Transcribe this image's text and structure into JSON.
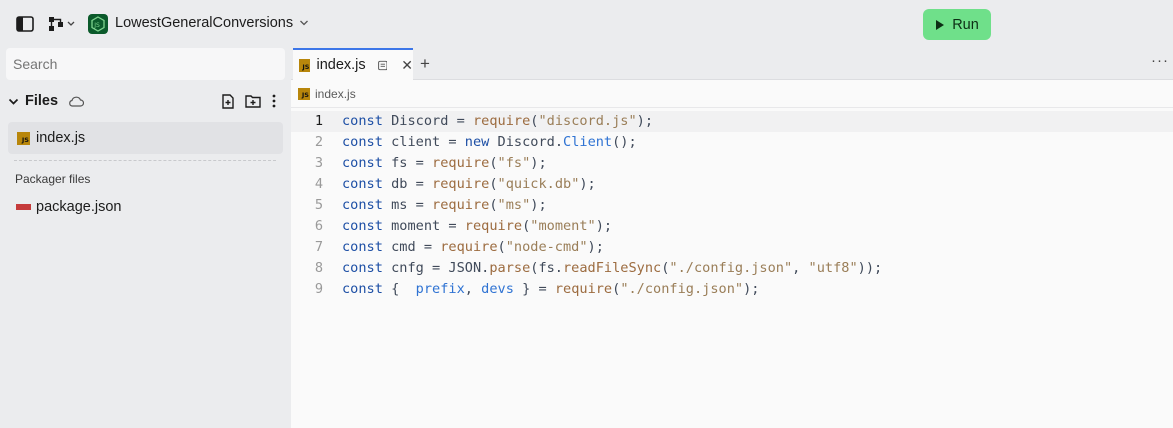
{
  "topbar": {
    "repl_name": "LowestGeneralConversions",
    "run_label": "Run"
  },
  "sidebar": {
    "search_placeholder": "Search",
    "files_title": "Files",
    "files": [
      {
        "name": "index.js",
        "icon": "js-file-icon"
      }
    ],
    "packager_label": "Packager files",
    "packager_files": [
      {
        "name": "package.json",
        "icon": "npm-icon"
      }
    ]
  },
  "editor": {
    "tab_label": "index.js",
    "breadcrumb": "index.js",
    "lines": [
      {
        "n": "1",
        "tokens": [
          [
            "kw",
            "const"
          ],
          [
            "id",
            " Discord "
          ],
          [
            "pu",
            "= "
          ],
          [
            "fn",
            "require"
          ],
          [
            "pu",
            "("
          ],
          [
            "str",
            "\"discord.js\""
          ],
          [
            "pu",
            ");"
          ]
        ]
      },
      {
        "n": "2",
        "tokens": [
          [
            "kw",
            "const"
          ],
          [
            "id",
            " client "
          ],
          [
            "pu",
            "= "
          ],
          [
            "kw",
            "new"
          ],
          [
            "id",
            " Discord."
          ],
          [
            "cls",
            "Client"
          ],
          [
            "pu",
            "();"
          ]
        ]
      },
      {
        "n": "3",
        "tokens": [
          [
            "kw",
            "const"
          ],
          [
            "id",
            " fs "
          ],
          [
            "pu",
            "= "
          ],
          [
            "fn",
            "require"
          ],
          [
            "pu",
            "("
          ],
          [
            "str",
            "\"fs\""
          ],
          [
            "pu",
            ");"
          ]
        ]
      },
      {
        "n": "4",
        "tokens": [
          [
            "kw",
            "const"
          ],
          [
            "id",
            " db "
          ],
          [
            "pu",
            "= "
          ],
          [
            "fn",
            "require"
          ],
          [
            "pu",
            "("
          ],
          [
            "str",
            "\"quick.db\""
          ],
          [
            "pu",
            ");"
          ]
        ]
      },
      {
        "n": "5",
        "tokens": [
          [
            "kw",
            "const"
          ],
          [
            "id",
            " ms "
          ],
          [
            "pu",
            "= "
          ],
          [
            "fn",
            "require"
          ],
          [
            "pu",
            "("
          ],
          [
            "str",
            "\"ms\""
          ],
          [
            "pu",
            ");"
          ]
        ]
      },
      {
        "n": "6",
        "tokens": [
          [
            "kw",
            "const"
          ],
          [
            "id",
            " moment "
          ],
          [
            "pu",
            "= "
          ],
          [
            "fn",
            "require"
          ],
          [
            "pu",
            "("
          ],
          [
            "str",
            "\"moment\""
          ],
          [
            "pu",
            ");"
          ]
        ]
      },
      {
        "n": "7",
        "tokens": [
          [
            "kw",
            "const"
          ],
          [
            "id",
            " cmd "
          ],
          [
            "pu",
            "= "
          ],
          [
            "fn",
            "require"
          ],
          [
            "pu",
            "("
          ],
          [
            "str",
            "\"node-cmd\""
          ],
          [
            "pu",
            ");"
          ]
        ]
      },
      {
        "n": "8",
        "tokens": [
          [
            "kw",
            "const"
          ],
          [
            "id",
            " cnfg "
          ],
          [
            "pu",
            "= "
          ],
          [
            "id",
            "JSON."
          ],
          [
            "fn",
            "parse"
          ],
          [
            "pu",
            "("
          ],
          [
            "id",
            "fs."
          ],
          [
            "fn",
            "readFileSync"
          ],
          [
            "pu",
            "("
          ],
          [
            "str",
            "\"./config.json\""
          ],
          [
            "pu",
            ", "
          ],
          [
            "str",
            "\"utf8\""
          ],
          [
            "pu",
            "));"
          ]
        ]
      },
      {
        "n": "9",
        "tokens": [
          [
            "kw",
            "const"
          ],
          [
            "pu",
            " {  "
          ],
          [
            "cls",
            "prefix"
          ],
          [
            "pu",
            ", "
          ],
          [
            "cls",
            "devs"
          ],
          [
            "pu",
            " } = "
          ],
          [
            "fn",
            "require"
          ],
          [
            "pu",
            "("
          ],
          [
            "str",
            "\"./config.json\""
          ],
          [
            "pu",
            ");"
          ]
        ]
      }
    ]
  },
  "colors": {
    "run_button": "#6fe08a",
    "active_tab_border": "#3c76e8",
    "keyword": "#1d4fa5"
  }
}
